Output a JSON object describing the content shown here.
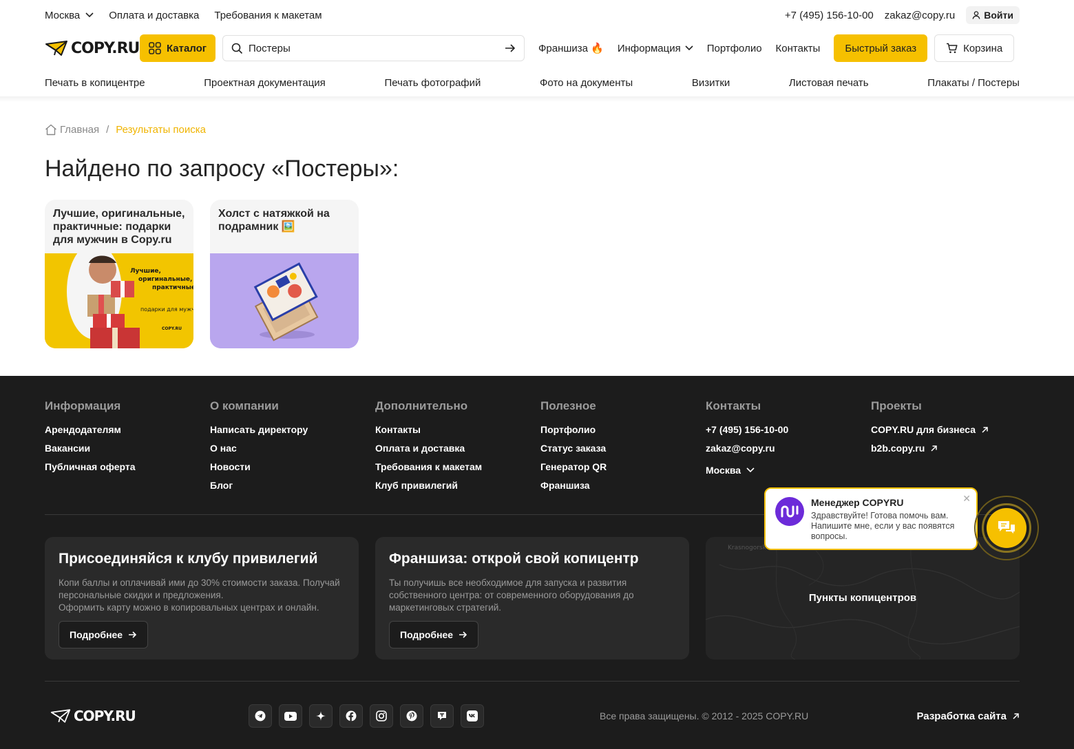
{
  "topbar": {
    "city": "Москва",
    "links": [
      "Оплата и доставка",
      "Требования к макетам"
    ],
    "phone": "+7 (495) 156-10-00",
    "email": "zakaz@copy.ru",
    "login": "Войти"
  },
  "header": {
    "logo": "COPY.RU",
    "catalog": "Каталог",
    "search_value": "Постеры",
    "nav": {
      "franchise": "Франшиза 🔥",
      "info": "Информация",
      "portfolio": "Портфолио",
      "contacts": "Контакты"
    },
    "quick_order": "Быстрый заказ",
    "cart": "Корзина"
  },
  "categories": [
    "Печать в копицентре",
    "Проектная документация",
    "Печать фотографий",
    "Фото на документы",
    "Визитки",
    "Листовая печать",
    "Плакаты / Постеры"
  ],
  "breadcrumb": {
    "home": "Главная",
    "separator": "/",
    "current": "Результаты поиска"
  },
  "page_title": "Найдено по запросу «Постеры»:",
  "results": [
    {
      "title": "Лучшие, оригинальные, практичные: подарки для мужчин в Copy.ru",
      "image_text": [
        "Лучшие,",
        "оригинальные,",
        "практичные",
        "подарки для мужч",
        "COPY.RU"
      ]
    },
    {
      "title": "Холст с натяжкой на подрамник 🖼️"
    }
  ],
  "footer": {
    "columns": [
      {
        "heading": "Информация",
        "items": [
          "Арендодателям",
          "Вакансии",
          "Публичная оферта"
        ]
      },
      {
        "heading": "О компании",
        "items": [
          "Написать директору",
          "О нас",
          "Новости",
          "Блог"
        ]
      },
      {
        "heading": "Дополнительно",
        "items": [
          "Контакты",
          "Оплата и доставка",
          "Требования к макетам",
          "Клуб привилегий"
        ]
      },
      {
        "heading": "Полезное",
        "items": [
          "Портфолио",
          "Статус заказа",
          "Генератор QR",
          "Франшиза"
        ]
      },
      {
        "heading": "Контакты",
        "items": [
          "+7 (495) 156-10-00",
          "zakaz@copy.ru"
        ],
        "city": "Москва"
      },
      {
        "heading": "Проекты",
        "items": [
          "COPY.RU для бизнеса",
          "b2b.copy.ru"
        ]
      }
    ],
    "promos": [
      {
        "title": "Присоединяйся к клубу привилегий",
        "text": "Копи баллы и оплачивай ими до 30% стоимости заказа. Получай персональные скидки и предложения.",
        "text2": "Оформить карту можно в копировальных центрах и онлайн.",
        "button": "Подробнее"
      },
      {
        "title": "Франшиза: открой свой копицентр",
        "text": "Ты получишь все необходимое для запуска и развития собственного центра: от современного оборудования до маркетинговых стратегий.",
        "button": "Подробнее"
      }
    ],
    "map": {
      "label": "Пункты копицентров",
      "place": "Krasnogorsk"
    },
    "logo": "COPY.RU",
    "socials": [
      "telegram-icon",
      "youtube-icon",
      "sparkle-icon",
      "facebook-icon",
      "instagram-icon",
      "pinterest-icon",
      "tenchat-icon",
      "vk-icon"
    ],
    "copyright": "Все права защищены. © 2012 - 2025 COPY.RU",
    "dev": "Разработка сайта"
  },
  "chat": {
    "name": "Менеджер COPYRU",
    "message": "Здравствуйте! Готова помочь вам. Напишите мне, если у вас появятся вопросы."
  },
  "colors": {
    "accent": "#f6c000",
    "footer_bg": "#1c1c1c",
    "breadcrumb_current": "#f0b400"
  }
}
